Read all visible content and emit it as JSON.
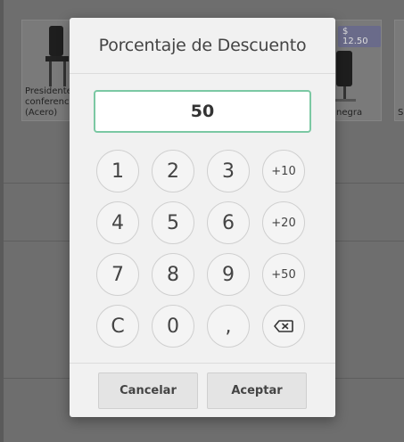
{
  "background": {
    "products": [
      {
        "name": "Presidente\nconferenci\n(Acero)"
      },
      {
        "name": "negra",
        "price": "$ 12.50"
      },
      {
        "name": "S"
      }
    ]
  },
  "dialog": {
    "title": "Porcentaje de Descuento",
    "value": "50",
    "keys": {
      "k1": "1",
      "k2": "2",
      "k3": "3",
      "plus10": "+10",
      "k4": "4",
      "k5": "5",
      "k6": "6",
      "plus20": "+20",
      "k7": "7",
      "k8": "8",
      "k9": "9",
      "plus50": "+50",
      "clear": "C",
      "k0": "0",
      "decimal": ","
    },
    "backspace_icon": "backspace-icon",
    "cancel_label": "Cancelar",
    "confirm_label": "Aceptar"
  },
  "colors": {
    "accent_border": "#7bc8a3",
    "overlay": "#6e6e6e",
    "modal_bg": "#f1f1f1"
  }
}
